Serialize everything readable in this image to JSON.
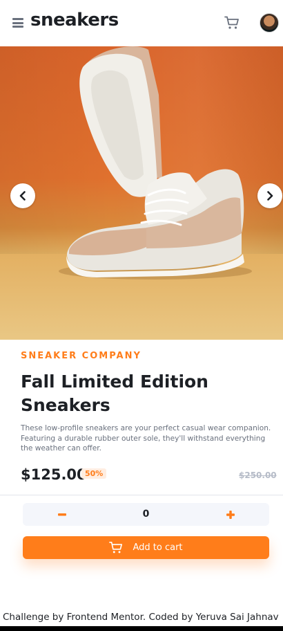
{
  "header": {
    "logo": "sneakers",
    "menu_icon": "hamburger-menu-icon",
    "cart_icon": "cart-icon",
    "avatar": "user-avatar"
  },
  "gallery": {
    "prev_icon": "chevron-left-icon",
    "next_icon": "chevron-right-icon"
  },
  "product": {
    "company": "SNEAKER COMPANY",
    "title": "Fall Limited Edition Sneakers",
    "description": "These low-profile sneakers are your perfect casual wear companion. Featuring a durable rubber outer sole, they'll withstand everything the weather can offer.",
    "price": "$125.00",
    "discount": "50%",
    "original_price": "$250.00"
  },
  "cart_controls": {
    "quantity": "0",
    "minus_icon": "minus-icon",
    "plus_icon": "plus-icon",
    "add_to_cart_label": "Add to cart"
  },
  "footer": {
    "attribution": "Challenge by Frontend Mentor. Coded by Yeruva Sai Jahnav"
  },
  "colors": {
    "accent": "#ff7d1a",
    "accent_light": "#ffede0",
    "text_dark": "#1d2025",
    "text_grey": "#69707d",
    "strike_grey": "#b6bcc8"
  }
}
